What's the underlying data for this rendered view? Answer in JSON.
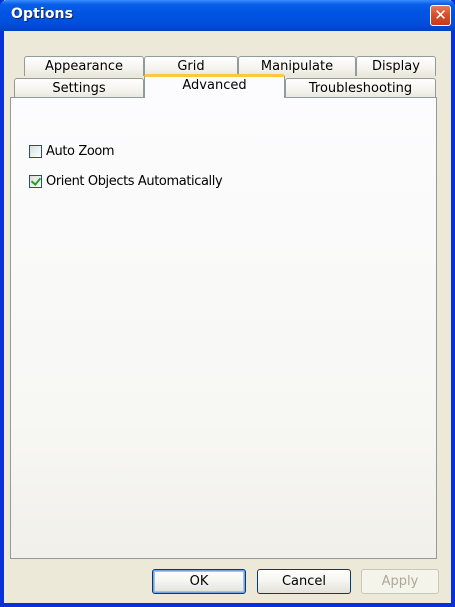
{
  "window": {
    "title": "Options",
    "close_glyph": "✕"
  },
  "tabs": {
    "row1": [
      {
        "label": "Appearance"
      },
      {
        "label": "Grid"
      },
      {
        "label": "Manipulate"
      },
      {
        "label": "Display"
      }
    ],
    "row2": [
      {
        "label": "Settings"
      },
      {
        "label": "Advanced",
        "selected": true
      },
      {
        "label": "Troubleshooting"
      }
    ]
  },
  "options": {
    "auto_zoom": {
      "label": "Auto Zoom",
      "checked": false
    },
    "orient_objects": {
      "label": "Orient Objects Automatically",
      "checked": true
    }
  },
  "buttons": {
    "ok": "OK",
    "cancel": "Cancel",
    "apply": "Apply"
  },
  "colors": {
    "titlebar": "#0054e3",
    "selected_tab_accent": "#ffc83c",
    "check_mark": "#21a121"
  }
}
